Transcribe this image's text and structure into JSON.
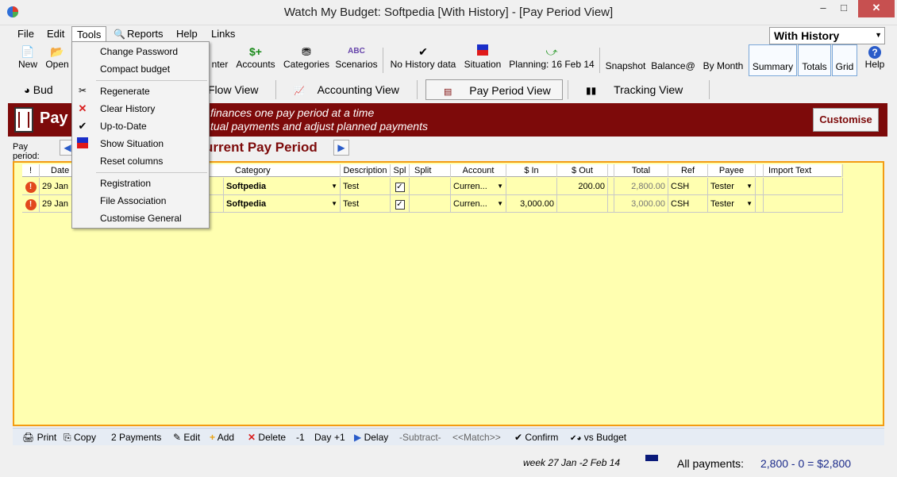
{
  "window": {
    "title": "Watch My Budget: Softpedia [With History] - [Pay Period View]",
    "minimize_glyph": "–",
    "maximize_glyph": "□",
    "close_glyph": "✕"
  },
  "menubar": [
    "File",
    "Edit",
    "Tools",
    "Reports",
    "Help",
    "Links"
  ],
  "history_select": {
    "value": "With History"
  },
  "toolbar": {
    "new": "New",
    "open": "Open",
    "enter": "nter",
    "accounts": "Accounts",
    "categories": "Categories",
    "scenarios": "Scenarios",
    "no_history": "No History data",
    "situation": "Situation",
    "planning": "Planning: 16 Feb 14",
    "snapshot": "Snapshot",
    "balance": "Balance@",
    "by_month": "By Month",
    "summary": "Summary",
    "totals": "Totals",
    "grid": "Grid",
    "help": "Help"
  },
  "view_tabs": {
    "budget": "Bud",
    "flow": "Flow View",
    "accounting": "Accounting View",
    "pay_period": "Pay Period View",
    "tracking": "Tracking View"
  },
  "banner": {
    "title": "Pay",
    "line1": "finances one pay period at a time",
    "line2": "tual payments and adjust planned payments",
    "customise": "Customise"
  },
  "pay_period": {
    "label": "Pay period:",
    "title": "urrent Pay Period",
    "prev_glyph": "◀",
    "next_glyph": "▶"
  },
  "grid": {
    "columns": [
      "!",
      "Date",
      "Category",
      "Description",
      "Spl",
      "Split",
      "Account",
      "$ In",
      "$ Out",
      "Total",
      "Ref",
      "Payee",
      "Import Text"
    ],
    "rows": [
      {
        "flag": "!",
        "date": "29 Jan",
        "category": "Softpedia",
        "description": "Test",
        "spl": "✓",
        "split": "",
        "account": "Curren...",
        "in": "",
        "out": "200.00",
        "total": "2,800.00",
        "ref": "CSH",
        "payee": "Tester",
        "import_text": ""
      },
      {
        "flag": "!",
        "date": "29 Jan",
        "category": "Softpedia",
        "description": "Test",
        "spl": "✓",
        "split": "",
        "account": "Curren...",
        "in": "3,000.00",
        "out": "",
        "total": "3,000.00",
        "ref": "CSH",
        "payee": "Tester",
        "import_text": ""
      }
    ]
  },
  "bottom_toolbar": {
    "print": "Print",
    "copy": "Copy",
    "payments": "2 Payments",
    "edit": "Edit",
    "add": "Add",
    "delete": "Delete",
    "minus1": "-1",
    "day": "Day",
    "plus1": "+1",
    "delay": "Delay",
    "subtract": "-Subtract-",
    "match": "<<Match>>",
    "confirm": "Confirm",
    "vs_budget": "vs Budget"
  },
  "status": {
    "week": "week 27 Jan -2 Feb 14",
    "all_payments_label": "All payments:",
    "all_payments_value": "2,800 - 0 = $2,800"
  },
  "tools_menu": {
    "items": [
      "Change Password",
      "Compact budget",
      "Regenerate",
      "Clear History",
      "Up-to-Date",
      "Show Situation",
      "Reset columns",
      "Registration",
      "File Association",
      "Customise General"
    ]
  },
  "colors": {
    "banner": "#7d0a0a",
    "grid_bg": "#ffffb0",
    "grid_border": "#f39c12",
    "warning": "#e2481c",
    "link_blue": "#2a5cc9"
  }
}
